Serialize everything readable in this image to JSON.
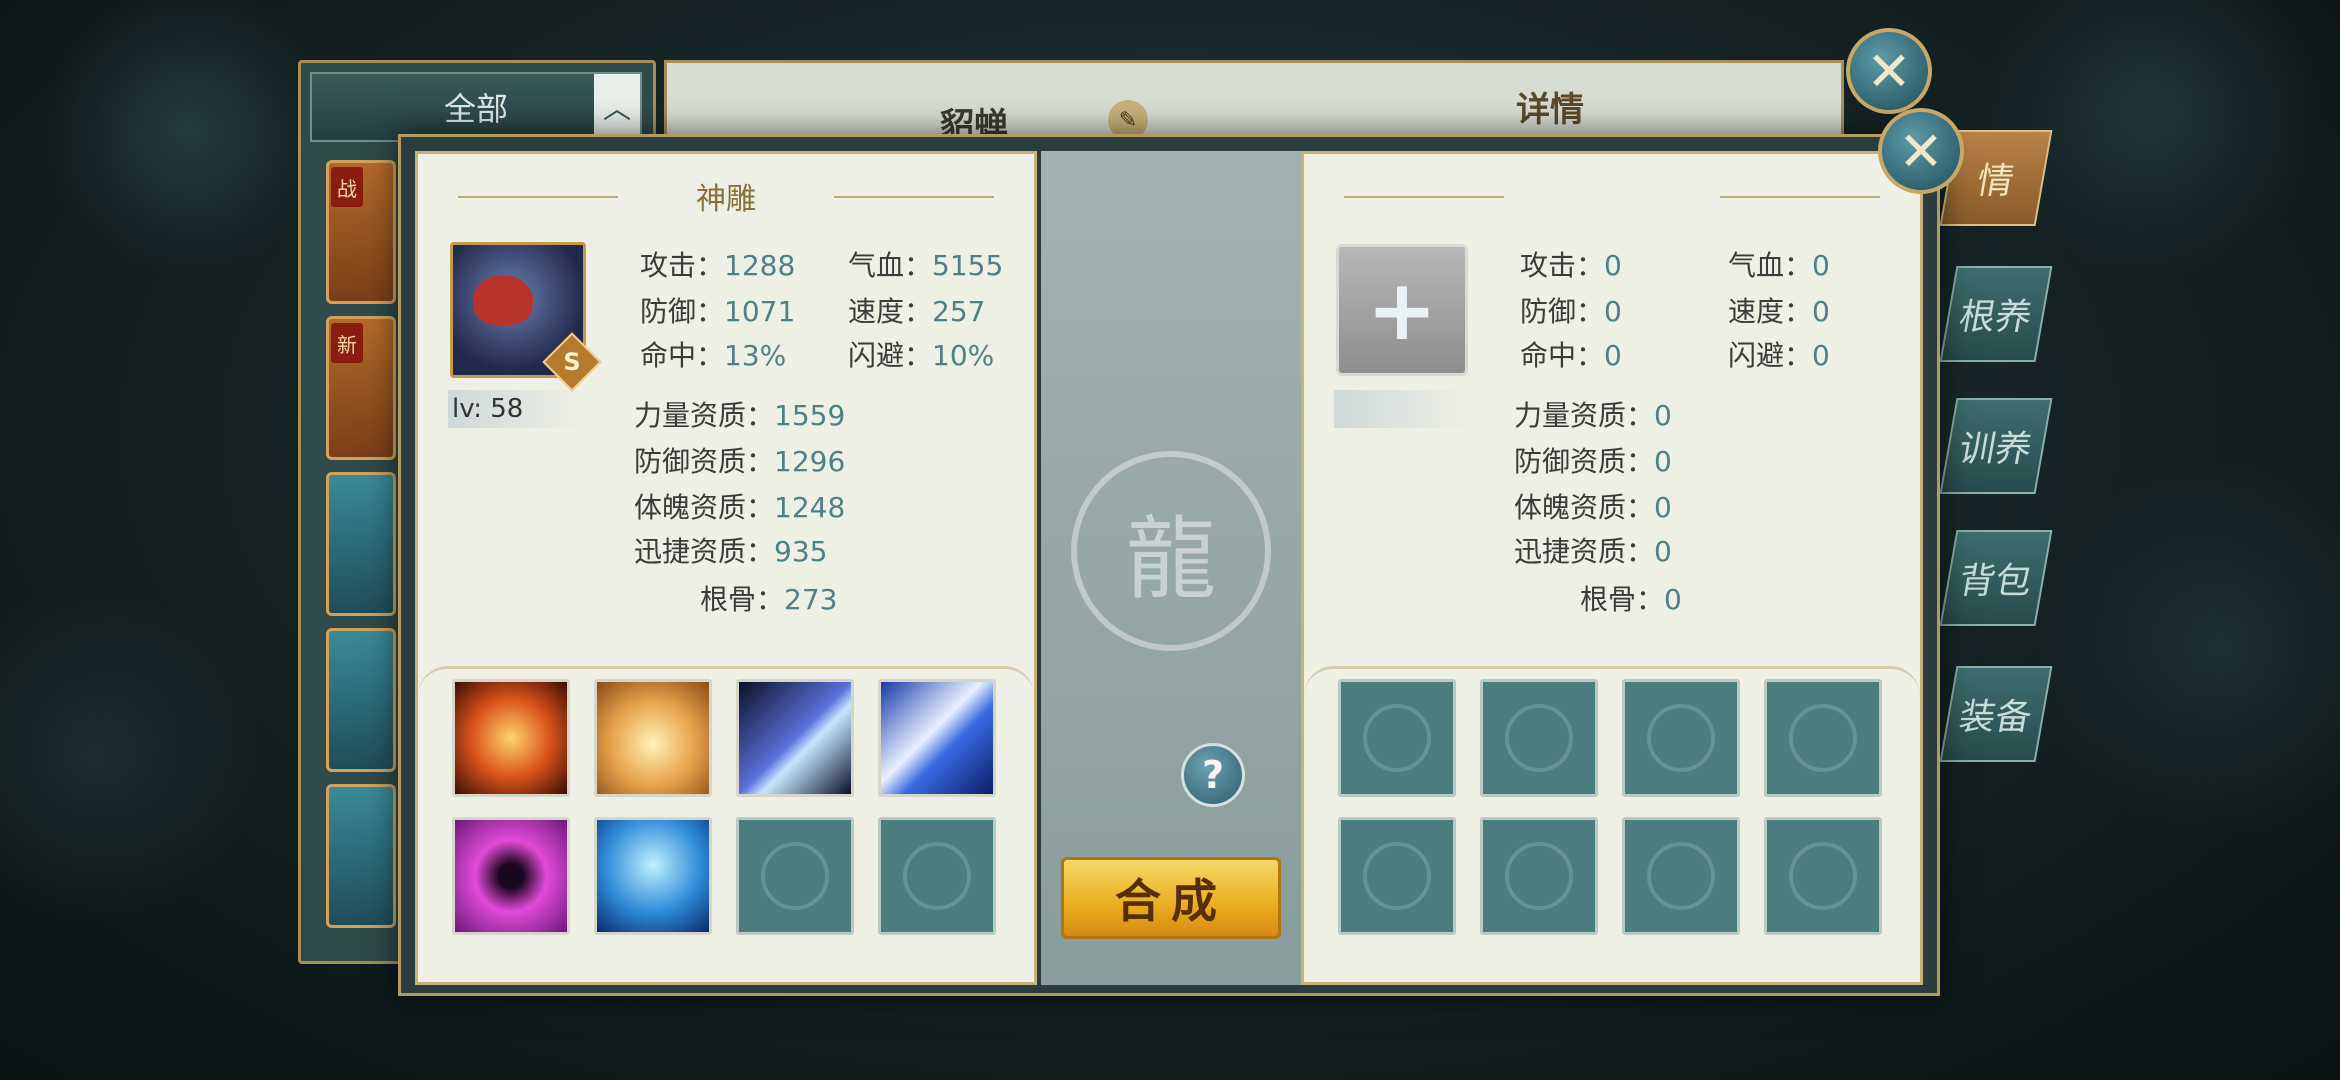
{
  "back": {
    "filter_label": "全部",
    "filter_toggle": "︿",
    "pet_tags": [
      "战",
      "新"
    ],
    "title": "貂蝉",
    "detail_tab": "详情",
    "side_tabs": [
      "情",
      "根养",
      "训养",
      "背包",
      "装备"
    ]
  },
  "close_icon": "✕",
  "left_panel": {
    "title": "神雕",
    "grade": "S",
    "level": "lv: 58",
    "stats": {
      "attack_label": "攻击：",
      "attack": "1288",
      "hp_label": "气血：",
      "hp": "5155",
      "defense_label": "防御：",
      "defense": "1071",
      "speed_label": "速度：",
      "speed": "257",
      "hit_label": "命中：",
      "hit": "13%",
      "dodge_label": "闪避：",
      "dodge": "10%",
      "str_apt_label": "力量资质：",
      "str_apt": "1559",
      "def_apt_label": "防御资质：",
      "def_apt": "1296",
      "con_apt_label": "体魄资质：",
      "con_apt": "1248",
      "agi_apt_label": "迅捷资质：",
      "agi_apt": "935",
      "bone_label": "根骨：",
      "bone": "273"
    },
    "skills": [
      "fire-phoenix-skill-icon",
      "golden-lion-skill-icon",
      "blue-claw-skill-icon",
      "lightning-arrow-skill-icon",
      "purple-vortex-skill-icon",
      "ice-shield-skill-icon",
      "empty",
      "empty"
    ]
  },
  "right_panel": {
    "add_icon": "+",
    "stats": {
      "attack_label": "攻击：",
      "attack": "0",
      "hp_label": "气血：",
      "hp": "0",
      "defense_label": "防御：",
      "defense": "0",
      "speed_label": "速度：",
      "speed": "0",
      "hit_label": "命中：",
      "hit": "0",
      "dodge_label": "闪避：",
      "dodge": "0",
      "str_apt_label": "力量资质：",
      "str_apt": "0",
      "def_apt_label": "防御资质：",
      "def_apt": "0",
      "con_apt_label": "体魄资质：",
      "con_apt": "0",
      "agi_apt_label": "迅捷资质：",
      "agi_apt": "0",
      "bone_label": "根骨：",
      "bone": "0"
    }
  },
  "middle": {
    "help_icon": "?",
    "combine_label": "合成"
  },
  "colors": {
    "accent_gold": "#b39a5e",
    "stat_value": "#4f7f88",
    "button_yellow": "#f4b41e",
    "teal_frame": "#2a3c3e"
  }
}
